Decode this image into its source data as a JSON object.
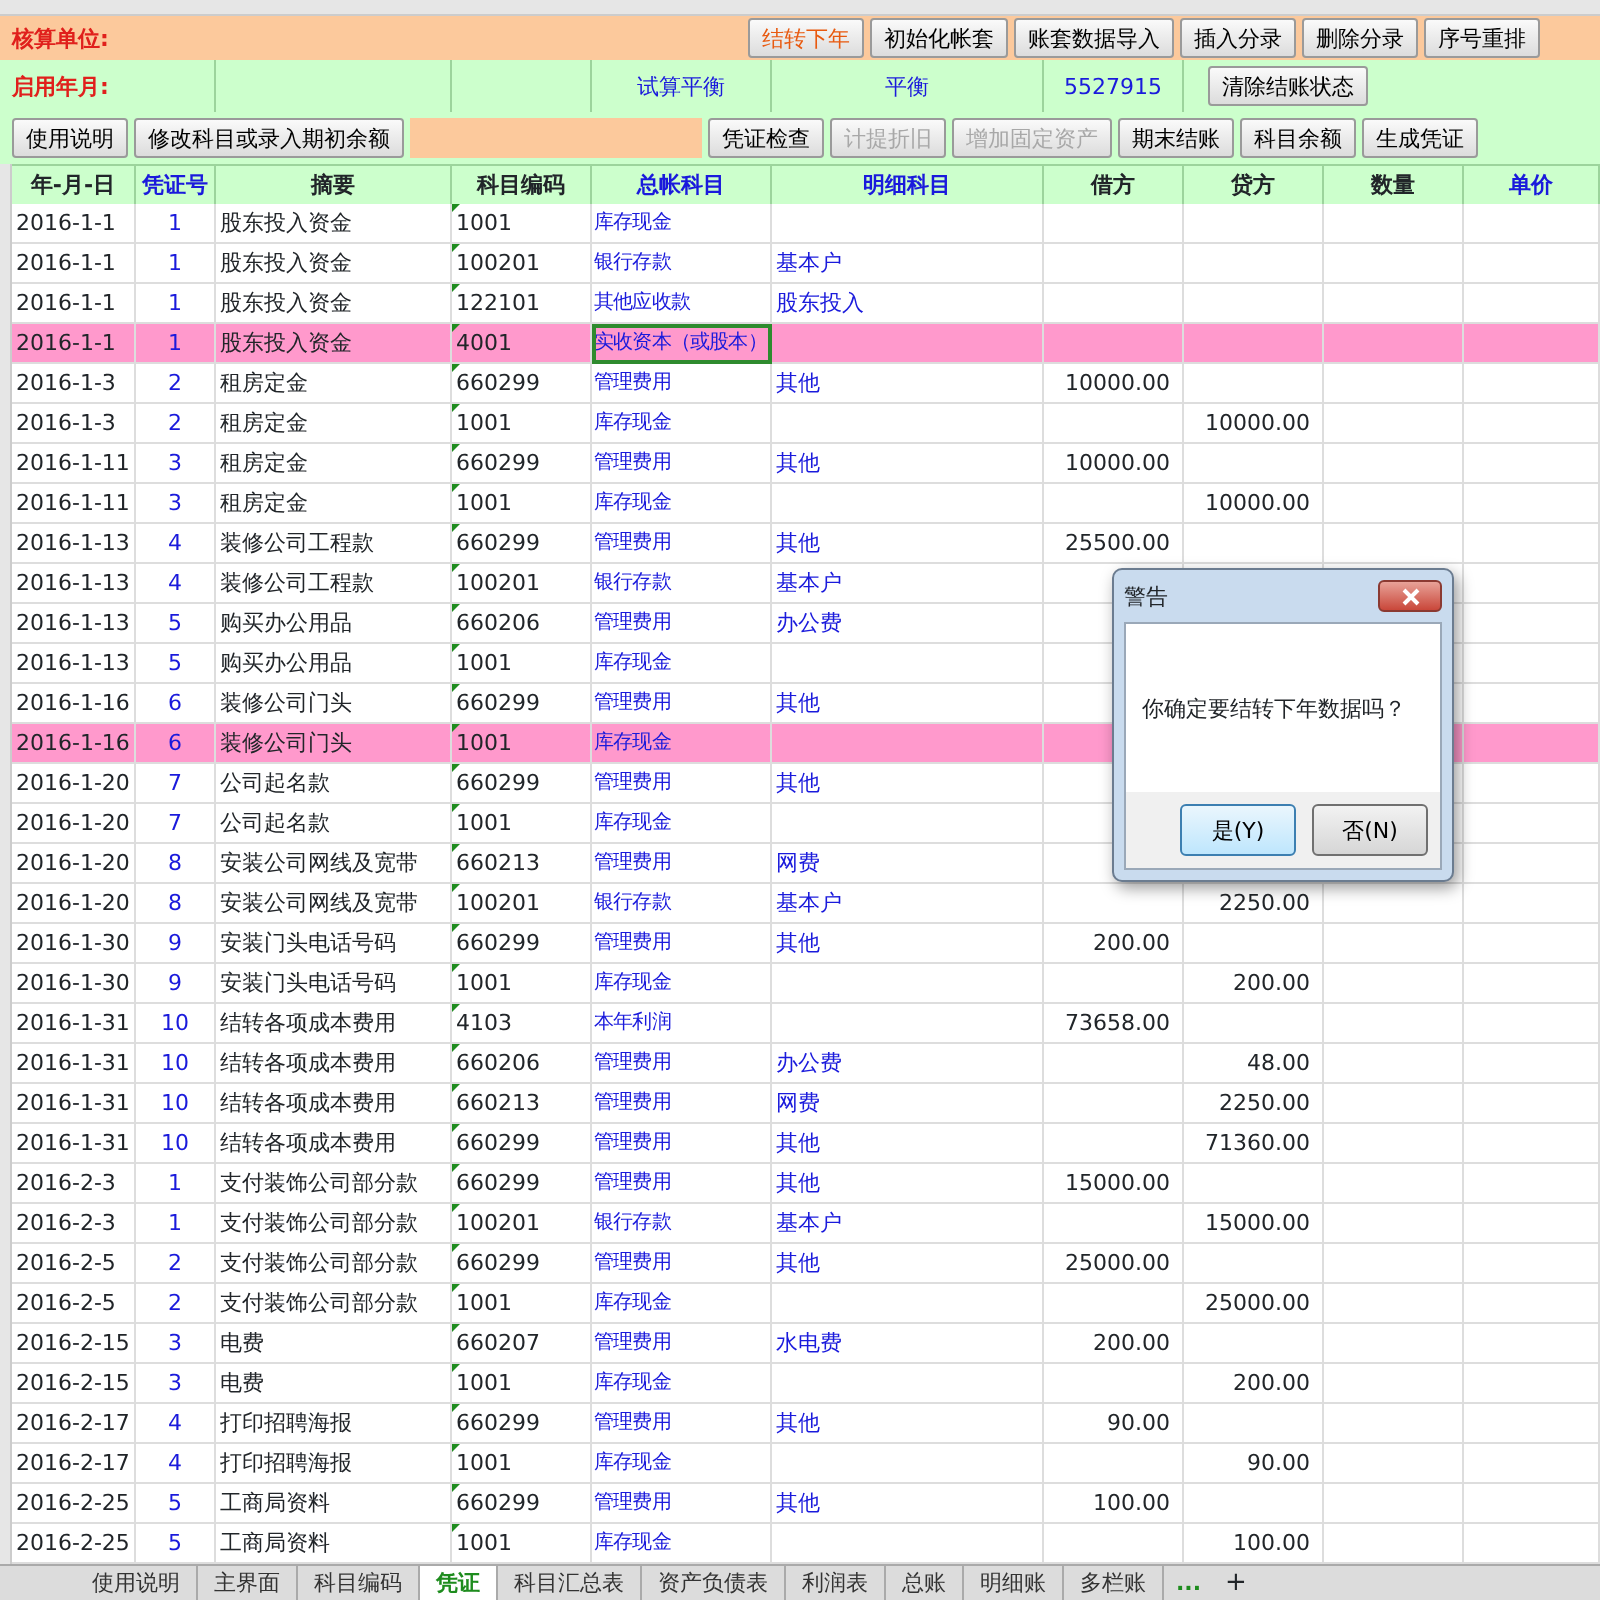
{
  "header_panel": {
    "unit_label": "核算单位:",
    "row1_buttons": [
      {
        "label": "结转下年",
        "accent": true
      },
      {
        "label": "初始化帐套",
        "accent": false
      },
      {
        "label": "账套数据导入",
        "accent": false
      },
      {
        "label": "插入分录",
        "accent": false
      },
      {
        "label": "删除分录",
        "accent": false
      },
      {
        "label": "序号重排",
        "accent": false
      }
    ],
    "start_label": "启用年月:",
    "balance_label": "试算平衡",
    "balance_status": "平衡",
    "check_number": "5527915",
    "row2_buttons": [
      {
        "label": "清除结账状态",
        "disabled": false
      }
    ],
    "row3_left_buttons": [
      {
        "label": "使用说明",
        "disabled": false
      },
      {
        "label": "修改科目或录入期初余额",
        "disabled": false
      }
    ],
    "row3_buttons": [
      {
        "label": "凭证检查",
        "disabled": false
      },
      {
        "label": "计提折旧",
        "disabled": true
      },
      {
        "label": "增加固定资产",
        "disabled": true
      },
      {
        "label": "期末结账",
        "disabled": false
      },
      {
        "label": "科目余额",
        "disabled": false
      },
      {
        "label": "生成凭证",
        "disabled": false
      }
    ]
  },
  "columns": [
    {
      "label": "年-月-日",
      "accent": false
    },
    {
      "label": "凭证号",
      "accent": true
    },
    {
      "label": "摘要",
      "accent": false
    },
    {
      "label": "科目编码",
      "accent": false
    },
    {
      "label": "总帐科目",
      "accent": true
    },
    {
      "label": "明细科目",
      "accent": true
    },
    {
      "label": "借方",
      "accent": false
    },
    {
      "label": "贷方",
      "accent": false
    },
    {
      "label": "数量",
      "accent": false
    },
    {
      "label": "单价",
      "accent": true
    }
  ],
  "rows": [
    {
      "date": "2016-1-1",
      "voucher": "1",
      "summary": "股东投入资金",
      "code": "1001",
      "account": "库存现金",
      "highlighted": false,
      "account_selected": false
    },
    {
      "date": "2016-1-1",
      "voucher": "1",
      "summary": "股东投入资金",
      "code": "100201",
      "account": "银行存款",
      "detail": "基本户",
      "highlighted": false,
      "account_selected": false
    },
    {
      "date": "2016-1-1",
      "voucher": "1",
      "summary": "股东投入资金",
      "code": "122101",
      "account": "其他应收款",
      "detail": "股东投入",
      "highlighted": false,
      "account_selected": false
    },
    {
      "date": "2016-1-1",
      "voucher": "1",
      "summary": "股东投入资金",
      "code": "4001",
      "account": "实收资本（或股本）",
      "highlighted": true,
      "account_selected": true
    },
    {
      "date": "2016-1-3",
      "voucher": "2",
      "summary": "租房定金",
      "code": "660299",
      "account": "管理费用",
      "detail": "其他",
      "debit": "10000.00",
      "highlighted": false,
      "account_selected": false
    },
    {
      "date": "2016-1-3",
      "voucher": "2",
      "summary": "租房定金",
      "code": "1001",
      "account": "库存现金",
      "credit": "10000.00",
      "highlighted": false,
      "account_selected": false
    },
    {
      "date": "2016-1-11",
      "voucher": "3",
      "summary": "租房定金",
      "code": "660299",
      "account": "管理费用",
      "detail": "其他",
      "debit": "10000.00",
      "highlighted": false,
      "account_selected": false
    },
    {
      "date": "2016-1-11",
      "voucher": "3",
      "summary": "租房定金",
      "code": "1001",
      "account": "库存现金",
      "credit": "10000.00",
      "highlighted": false,
      "account_selected": false
    },
    {
      "date": "2016-1-13",
      "voucher": "4",
      "summary": "装修公司工程款",
      "code": "660299",
      "account": "管理费用",
      "detail": "其他",
      "debit": "25500.00",
      "highlighted": false,
      "account_selected": false
    },
    {
      "date": "2016-1-13",
      "voucher": "4",
      "summary": "装修公司工程款",
      "code": "100201",
      "account": "银行存款",
      "detail": "基本户",
      "highlighted": false,
      "account_selected": false
    },
    {
      "date": "2016-1-13",
      "voucher": "5",
      "summary": "购买办公用品",
      "code": "660206",
      "account": "管理费用",
      "detail": "办公费",
      "highlighted": false,
      "account_selected": false
    },
    {
      "date": "2016-1-13",
      "voucher": "5",
      "summary": "购买办公用品",
      "code": "1001",
      "account": "库存现金",
      "highlighted": false,
      "account_selected": false
    },
    {
      "date": "2016-1-16",
      "voucher": "6",
      "summary": "装修公司门头",
      "code": "660299",
      "account": "管理费用",
      "detail": "其他",
      "highlighted": false,
      "account_selected": false
    },
    {
      "date": "2016-1-16",
      "voucher": "6",
      "summary": "装修公司门头",
      "code": "1001",
      "account": "库存现金",
      "highlighted": true,
      "account_selected": false
    },
    {
      "date": "2016-1-20",
      "voucher": "7",
      "summary": "公司起名款",
      "code": "660299",
      "account": "管理费用",
      "detail": "其他",
      "highlighted": false,
      "account_selected": false
    },
    {
      "date": "2016-1-20",
      "voucher": "7",
      "summary": "公司起名款",
      "code": "1001",
      "account": "库存现金",
      "highlighted": false,
      "account_selected": false
    },
    {
      "date": "2016-1-20",
      "voucher": "8",
      "summary": "安装公司网线及宽带",
      "code": "660213",
      "account": "管理费用",
      "detail": "网费",
      "highlighted": false,
      "account_selected": false
    },
    {
      "date": "2016-1-20",
      "voucher": "8",
      "summary": "安装公司网线及宽带",
      "code": "100201",
      "account": "银行存款",
      "detail": "基本户",
      "credit": "2250.00",
      "highlighted": false,
      "account_selected": false
    },
    {
      "date": "2016-1-30",
      "voucher": "9",
      "summary": "安装门头电话号码",
      "code": "660299",
      "account": "管理费用",
      "detail": "其他",
      "debit": "200.00",
      "highlighted": false,
      "account_selected": false
    },
    {
      "date": "2016-1-30",
      "voucher": "9",
      "summary": "安装门头电话号码",
      "code": "1001",
      "account": "库存现金",
      "credit": "200.00",
      "highlighted": false,
      "account_selected": false
    },
    {
      "date": "2016-1-31",
      "voucher": "10",
      "summary": "结转各项成本费用",
      "code": "4103",
      "account": "本年利润",
      "debit": "73658.00",
      "highlighted": false,
      "account_selected": false
    },
    {
      "date": "2016-1-31",
      "voucher": "10",
      "summary": "结转各项成本费用",
      "code": "660206",
      "account": "管理费用",
      "detail": "办公费",
      "credit": "48.00",
      "highlighted": false,
      "account_selected": false
    },
    {
      "date": "2016-1-31",
      "voucher": "10",
      "summary": "结转各项成本费用",
      "code": "660213",
      "account": "管理费用",
      "detail": "网费",
      "credit": "2250.00",
      "highlighted": false,
      "account_selected": false
    },
    {
      "date": "2016-1-31",
      "voucher": "10",
      "summary": "结转各项成本费用",
      "code": "660299",
      "account": "管理费用",
      "detail": "其他",
      "credit": "71360.00",
      "highlighted": false,
      "account_selected": false
    },
    {
      "date": "2016-2-3",
      "voucher": "1",
      "summary": "支付装饰公司部分款",
      "code": "660299",
      "account": "管理费用",
      "detail": "其他",
      "debit": "15000.00",
      "highlighted": false,
      "account_selected": false
    },
    {
      "date": "2016-2-3",
      "voucher": "1",
      "summary": "支付装饰公司部分款",
      "code": "100201",
      "account": "银行存款",
      "detail": "基本户",
      "credit": "15000.00",
      "highlighted": false,
      "account_selected": false
    },
    {
      "date": "2016-2-5",
      "voucher": "2",
      "summary": "支付装饰公司部分款",
      "code": "660299",
      "account": "管理费用",
      "detail": "其他",
      "debit": "25000.00",
      "highlighted": false,
      "account_selected": false
    },
    {
      "date": "2016-2-5",
      "voucher": "2",
      "summary": "支付装饰公司部分款",
      "code": "1001",
      "account": "库存现金",
      "credit": "25000.00",
      "highlighted": false,
      "account_selected": false
    },
    {
      "date": "2016-2-15",
      "voucher": "3",
      "summary": "电费",
      "code": "660207",
      "account": "管理费用",
      "detail": "水电费",
      "debit": "200.00",
      "highlighted": false,
      "account_selected": false
    },
    {
      "date": "2016-2-15",
      "voucher": "3",
      "summary": "电费",
      "code": "1001",
      "account": "库存现金",
      "credit": "200.00",
      "highlighted": false,
      "account_selected": false
    },
    {
      "date": "2016-2-17",
      "voucher": "4",
      "summary": "打印招聘海报",
      "code": "660299",
      "account": "管理费用",
      "detail": "其他",
      "debit": "90.00",
      "highlighted": false,
      "account_selected": false
    },
    {
      "date": "2016-2-17",
      "voucher": "4",
      "summary": "打印招聘海报",
      "code": "1001",
      "account": "库存现金",
      "credit": "90.00",
      "highlighted": false,
      "account_selected": false
    },
    {
      "date": "2016-2-25",
      "voucher": "5",
      "summary": "工商局资料",
      "code": "660299",
      "account": "管理费用",
      "detail": "其他",
      "debit": "100.00",
      "highlighted": false,
      "account_selected": false
    },
    {
      "date": "2016-2-25",
      "voucher": "5",
      "summary": "工商局资料",
      "code": "1001",
      "account": "库存现金",
      "credit": "100.00",
      "highlighted": false,
      "account_selected": false
    }
  ],
  "sheet_tabs": [
    {
      "label": "使用说明",
      "selected": false
    },
    {
      "label": "主界面",
      "selected": false
    },
    {
      "label": "科目编码",
      "selected": false
    },
    {
      "label": "凭证",
      "selected": true
    },
    {
      "label": "科目汇总表",
      "selected": false
    },
    {
      "label": "资产负债表",
      "selected": false
    },
    {
      "label": "利润表",
      "selected": false
    },
    {
      "label": "总账",
      "selected": false
    },
    {
      "label": "明细账",
      "selected": false
    },
    {
      "label": "多栏账",
      "selected": false
    }
  ],
  "tab_more": "...",
  "tab_add": "+",
  "dialog": {
    "title": "警告",
    "message": "你确定要结转下年数据吗？",
    "buttons": [
      {
        "label": "是(Y)",
        "default": true
      },
      {
        "label": "否(N)",
        "default": false
      }
    ]
  }
}
